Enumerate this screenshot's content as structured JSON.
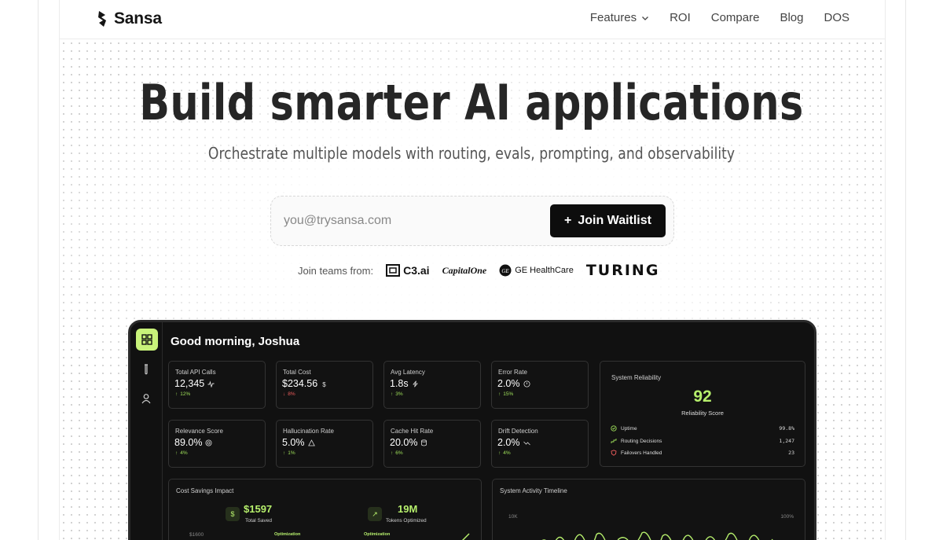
{
  "nav": {
    "brand": "Sansa",
    "links": [
      "Features",
      "ROI",
      "Compare",
      "Blog",
      "DOS"
    ]
  },
  "hero": {
    "title": "Build smarter AI applications",
    "subtitle": "Orchestrate multiple models with routing, evals, prompting, and observability",
    "email_placeholder": "you@trysansa.com",
    "cta": "Join Waitlist",
    "teams_label": "Join teams from:",
    "brands": [
      "C3.ai",
      "CapitalOne",
      "GE HealthCare",
      "TURING"
    ]
  },
  "dashboard": {
    "greeting": "Good morning, Joshua",
    "metrics": [
      {
        "label": "Total API Calls",
        "value": "12,345",
        "change": "12%",
        "dir": "up",
        "icon": "activity-icon"
      },
      {
        "label": "Total Cost",
        "value": "$234.56",
        "change": "8%",
        "dir": "down",
        "icon": "dollar-icon"
      },
      {
        "label": "Avg Latency",
        "value": "1.8s",
        "change": "3%",
        "dir": "up",
        "icon": "zap-icon"
      },
      {
        "label": "Error Rate",
        "value": "2.0%",
        "change": "15%",
        "dir": "up",
        "icon": "alert-circle-icon"
      },
      {
        "label": "Relevance Score",
        "value": "89.0%",
        "change": "4%",
        "dir": "up",
        "icon": "target-icon"
      },
      {
        "label": "Hallucination Rate",
        "value": "5.0%",
        "change": "1%",
        "dir": "up",
        "icon": "warning-icon"
      },
      {
        "label": "Cache Hit Rate",
        "value": "20.0%",
        "change": "6%",
        "dir": "up",
        "icon": "database-icon"
      },
      {
        "label": "Drift Detection",
        "value": "2.0%",
        "change": "4%",
        "dir": "up",
        "icon": "trend-icon"
      }
    ],
    "reliability": {
      "title": "System Reliability",
      "score": "92",
      "score_label": "Reliability Score",
      "rows": [
        {
          "label": "Uptime",
          "value": "99.8%",
          "icon": "check-circle-icon"
        },
        {
          "label": "Routing Decisions",
          "value": "1,247",
          "icon": "route-icon"
        },
        {
          "label": "Failovers Handled",
          "value": "23",
          "icon": "shield-icon"
        }
      ]
    },
    "savings": {
      "title": "Cost Savings Impact",
      "total_saved": "$1597",
      "total_saved_label": "Total Saved",
      "tokens": "19M",
      "tokens_label": "Tokens Optimized",
      "axis_top": "$1600",
      "opt_label": "Optimization"
    },
    "timeline": {
      "title": "System Activity Timeline",
      "left_axis": "10K",
      "right_axis": "100%"
    }
  },
  "colors": {
    "accent": "#b6ef6c",
    "dark": "#111111",
    "down": "#f05d5d"
  }
}
